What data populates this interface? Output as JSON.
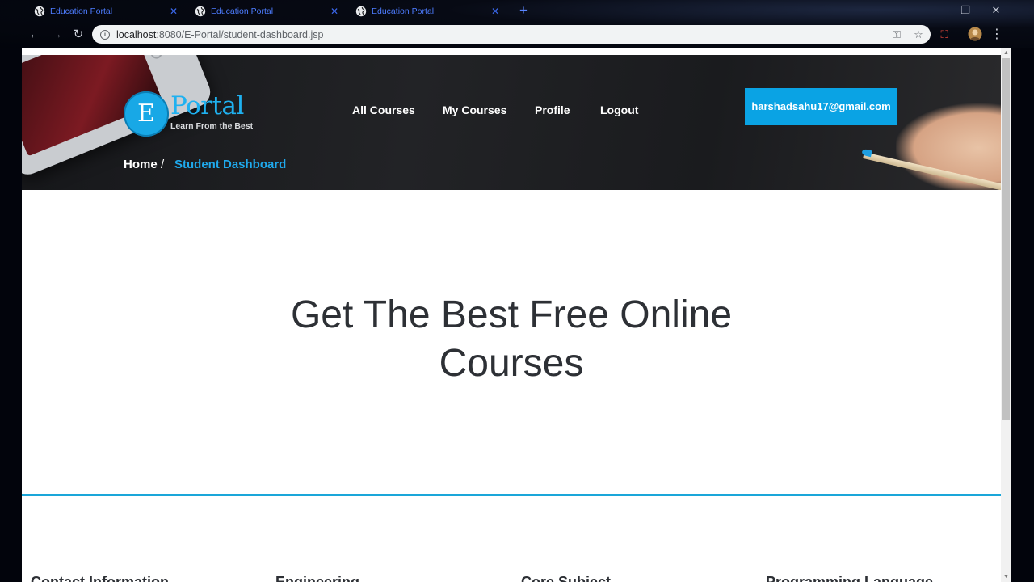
{
  "browser": {
    "tabs": [
      {
        "title": "Education Portal",
        "icon": "globe-icon"
      },
      {
        "title": "Education Portal",
        "icon": "globe-icon"
      },
      {
        "title": "Education Portal",
        "icon": "globe-icon"
      }
    ],
    "new_tab": "+",
    "url_host": "localhost",
    "url_path": ":8080/E-Portal/student-dashboard.jsp"
  },
  "site": {
    "logo_letter": "E",
    "logo_word": "Portal",
    "logo_tagline": "Learn From the Best",
    "nav": [
      "All Courses",
      "My Courses",
      "Profile",
      "Logout"
    ],
    "user_email": "harshadsahu17@gmail.com",
    "breadcrumb": {
      "home": "Home",
      "separator": "/",
      "current": "Student Dashboard"
    },
    "headline": [
      "Get The Best Free Online",
      "Courses"
    ],
    "footer_columns": [
      "Contact Information",
      "Engineering",
      "Core Subject",
      "Programming Language"
    ],
    "colors": {
      "accent": "#0aa3e4",
      "divider": "#1aa6d9",
      "hero_bg": "#1c1d20"
    }
  }
}
